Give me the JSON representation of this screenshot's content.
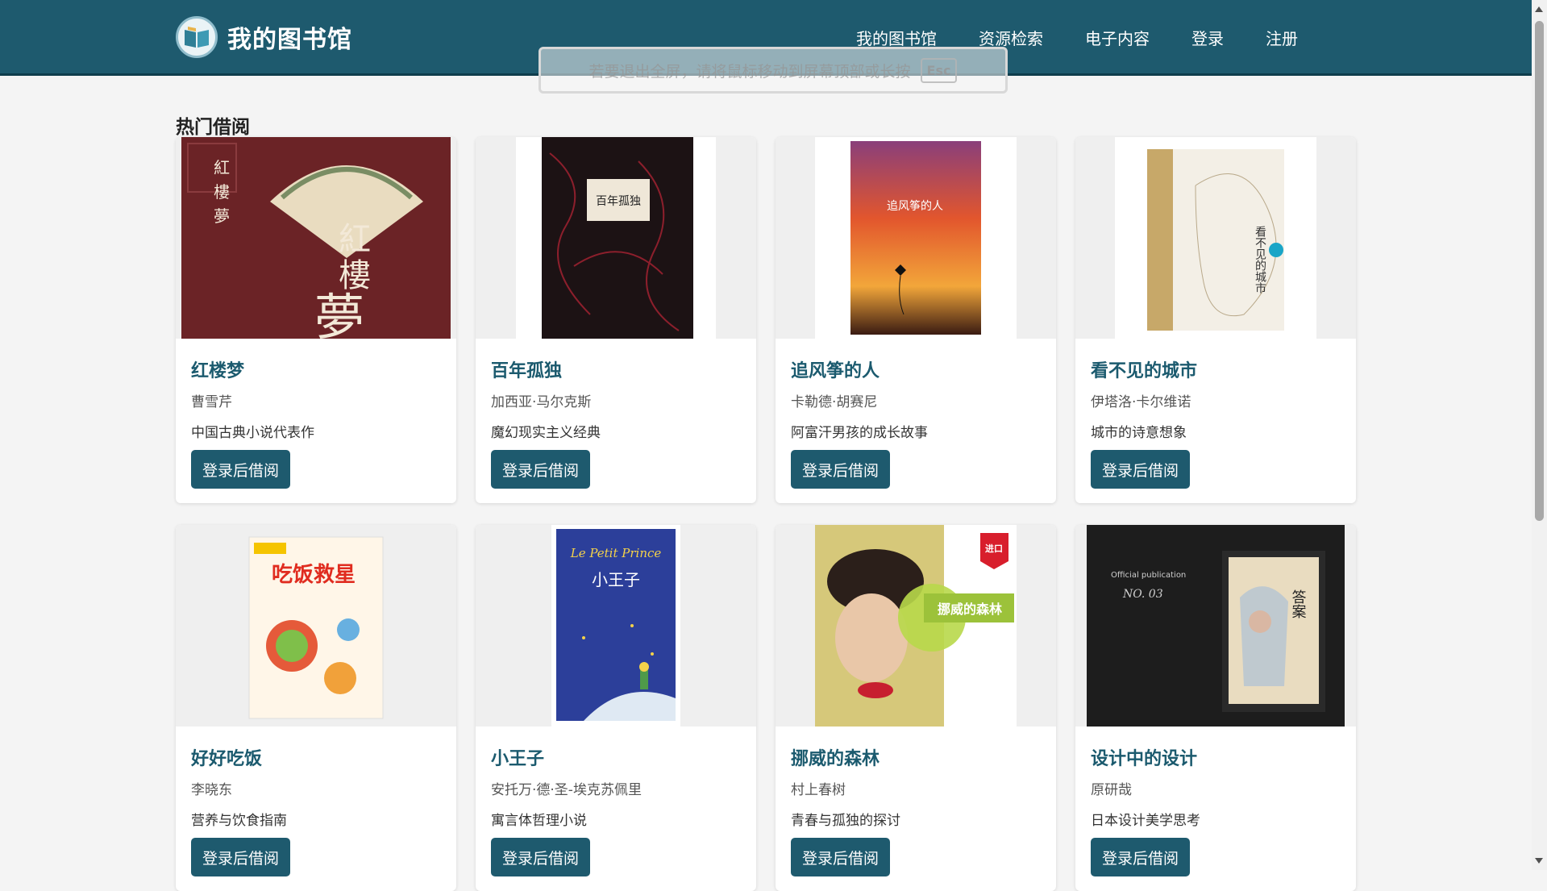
{
  "header": {
    "logo_icon": "library-book-logo-icon",
    "title": "我的图书馆",
    "nav": [
      "我的图书馆",
      "资源检索",
      "电子内容",
      "登录",
      "注册"
    ]
  },
  "fullscreen_toast": {
    "text": "若要退出全屏，请将鼠标移动到屏幕顶部或长按",
    "key": "Esc"
  },
  "section": {
    "title": "热门借阅"
  },
  "books": [
    {
      "title": "红楼梦",
      "author": "曹雪芹",
      "desc": "中国古典小说代表作",
      "button": "登录后借阅",
      "cover_bg": "#6b2326",
      "cover_text": "红楼夢"
    },
    {
      "title": "百年孤独",
      "author": "加西亚·马尔克斯",
      "desc": "魔幻现实主义经典",
      "button": "登录后借阅",
      "cover_bg": "#1c1214",
      "cover_text": "百年孤独"
    },
    {
      "title": "追风筝的人",
      "author": "卡勒德·胡赛尼",
      "desc": "阿富汗男孩的成长故事",
      "button": "登录后借阅",
      "cover_bg": "#c2452a",
      "cover_text": "追风筝的人"
    },
    {
      "title": "看不见的城市",
      "author": "伊塔洛·卡尔维诺",
      "desc": "城市的诗意想象",
      "button": "登录后借阅",
      "cover_bg": "#f3efe6",
      "cover_text": "看不见的城市"
    },
    {
      "title": "好好吃饭",
      "author": "李晓东",
      "desc": "营养与饮食指南",
      "button": "登录后借阅",
      "cover_bg": "#fff6e8",
      "cover_text": "吃饭救星"
    },
    {
      "title": "小王子",
      "author": "安托万·德·圣-埃克苏佩里",
      "desc": "寓言体哲理小说",
      "button": "登录后借阅",
      "cover_bg": "#2c3f9a",
      "cover_text": "小王子"
    },
    {
      "title": "挪威的森林",
      "author": "村上春树",
      "desc": "青春与孤独的探讨",
      "button": "登录后借阅",
      "cover_bg": "#c9c26a",
      "cover_text": "挪威的森林"
    },
    {
      "title": "设计中的设计",
      "author": "原研哉",
      "desc": "日本设计美学思考",
      "button": "登录后借阅",
      "cover_bg": "#1d1d1d",
      "cover_text": "答案"
    }
  ]
}
